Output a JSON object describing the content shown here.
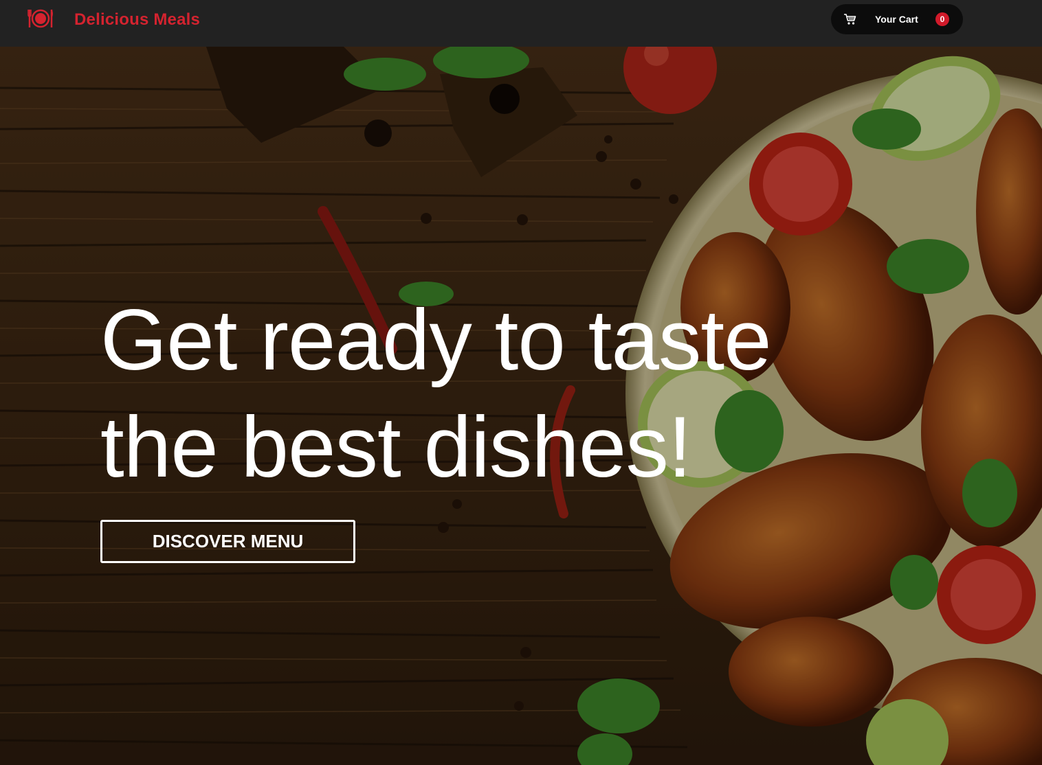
{
  "navbar": {
    "brand": "Delicious Meals",
    "logo_icon": "plate-cutlery-icon",
    "cart": {
      "label": "Your Cart",
      "count": "0",
      "icon": "shopping-cart-icon"
    }
  },
  "hero": {
    "headline_line1": "Get ready to taste",
    "headline_line2": "the best dishes!",
    "cta_label": "DISCOVER MENU",
    "background_image": "grilled chicken wings plate on wooden table"
  },
  "colors": {
    "brand": "#d4232f",
    "navbar_bg": "#222222",
    "cart_bg": "#0c0c0c",
    "badge": "#d11a2a",
    "text": "#ffffff"
  }
}
